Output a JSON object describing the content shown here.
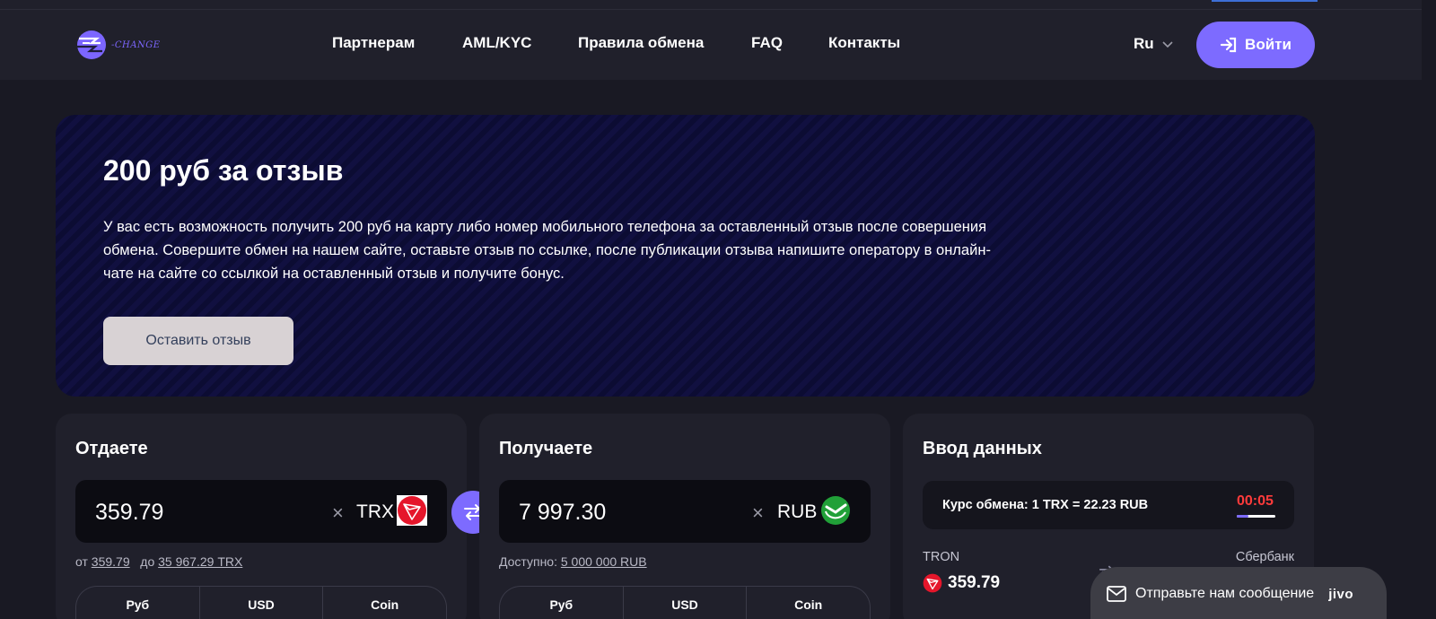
{
  "header": {
    "logo_text": "-CHANGE",
    "nav": [
      {
        "label": "Партнерам"
      },
      {
        "label": "AML/KYC"
      },
      {
        "label": "Правила обмена"
      },
      {
        "label": "FAQ"
      },
      {
        "label": "Контакты"
      }
    ],
    "language": "Ru",
    "login_label": "Войти"
  },
  "promo": {
    "title": "200 руб за отзыв",
    "text": "У вас есть возможность получить 200 руб на карту либо номер мобильного телефона за оставленный отзыв после совершения обмена. Совершите обмен на нашем сайте, оставьте отзыв по ссылке, после публикации отзыва напишите оператору в онлайн-чате на сайте со ссылкой на оставленный отзыв и получите бонус.",
    "button_label": "Оставить отзыв"
  },
  "give": {
    "title": "Отдаете",
    "amount": "359.79",
    "currency": "TRX",
    "clear_symbol": "×",
    "range_from_label": "от",
    "range_from_value": "359.79",
    "range_to_label": "до",
    "range_to_value": "35 967.29 TRX",
    "tabs": [
      {
        "label": "Руб"
      },
      {
        "label": "USD"
      },
      {
        "label": "Coin"
      }
    ]
  },
  "receive": {
    "title": "Получаете",
    "amount": "7 997.30",
    "currency": "RUB",
    "clear_symbol": "×",
    "available_label": "Доступно:",
    "available_value": "5 000 000 RUB",
    "tabs": [
      {
        "label": "Руб"
      },
      {
        "label": "USD"
      },
      {
        "label": "Coin"
      }
    ]
  },
  "details": {
    "title": "Ввод данных",
    "rate_text": "Курс обмена: 1 TRX = 22.23 RUB",
    "timer": "00:05",
    "timer_progress": 0.3,
    "from_name": "TRON",
    "from_amount": "359.79",
    "to_name": "Сбербанк"
  },
  "chat": {
    "label": "Отправьте нам сообщение",
    "brand": "jivo"
  },
  "colors": {
    "accent": "#7d6bff",
    "tron_red": "#e5162b",
    "sber_green": "#21a038",
    "timer_red": "#ff3b3b"
  },
  "icons": {
    "login": "login-arrow-icon",
    "swap": "swap-arrows-icon",
    "chat": "mail-icon",
    "tron": "tron-logo-icon",
    "sber": "sber-logo-icon"
  }
}
